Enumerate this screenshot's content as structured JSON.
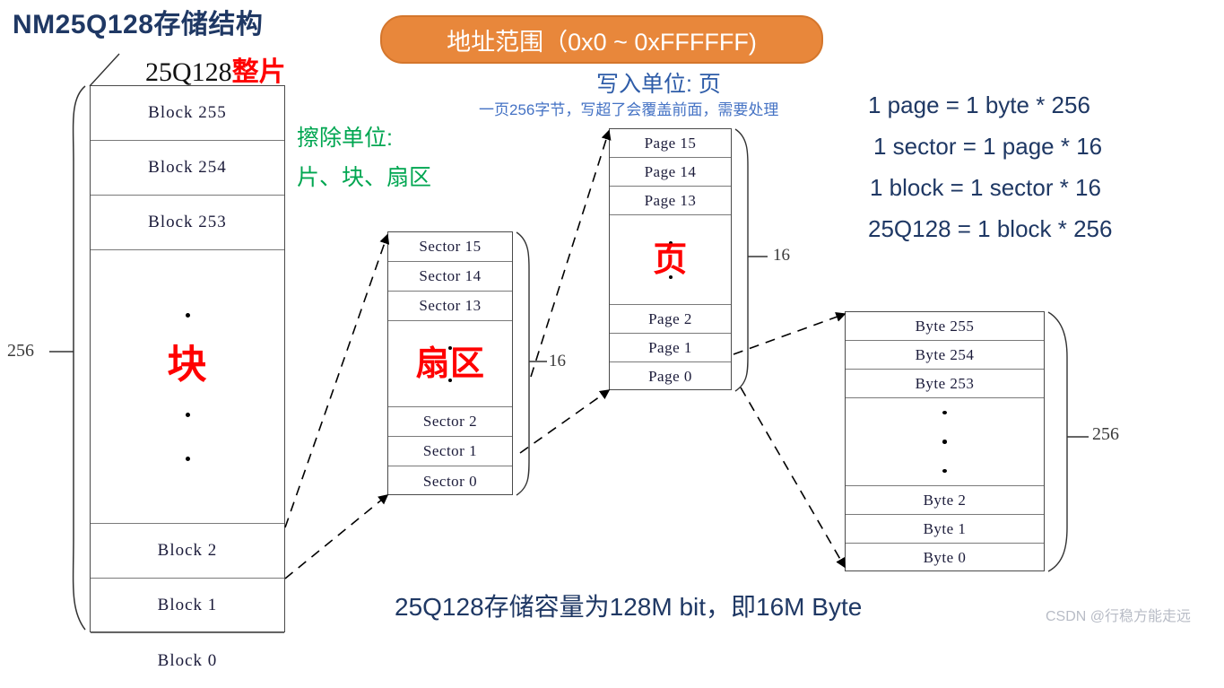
{
  "title": "NM25Q128存储结构",
  "chip_label": {
    "prefix": "25Q128",
    "highlight": "整片"
  },
  "address_badge": "地址范围（0x0 ~ 0xFFFFFF)",
  "annotations": {
    "write_unit": "写入单位: 页",
    "write_note": "一页256字节，写超了会覆盖前面，需要处理",
    "erase_unit": "擦除单位:",
    "erase_list": "片、块、扇区"
  },
  "equations": [
    "1 page = 1 byte * 256",
    "1 sector = 1 page * 16",
    "1 block = 1 sector * 16",
    "25Q128 = 1 block * 256"
  ],
  "columns": {
    "block": {
      "name": "Block",
      "top_cells": [
        "Block 255",
        "Block 254",
        "Block 253"
      ],
      "middle_label": "块",
      "bottom_cells": [
        "Block 2",
        "Block 1",
        "Block 0"
      ],
      "count_label": "256"
    },
    "sector": {
      "name": "Sector",
      "top_cells": [
        "Sector 15",
        "Sector 14",
        "Sector 13"
      ],
      "middle_label": "扇区",
      "bottom_cells": [
        "Sector 2",
        "Sector 1",
        "Sector 0"
      ],
      "count_label": "16"
    },
    "page": {
      "name": "Page",
      "top_cells": [
        "Page 15",
        "Page 14",
        "Page 13"
      ],
      "middle_label": "页",
      "bottom_cells": [
        "Page 2",
        "Page 1",
        "Page 0"
      ],
      "count_label": "16"
    },
    "byte": {
      "name": "Byte",
      "top_cells": [
        "Byte 255",
        "Byte 254",
        "Byte 253"
      ],
      "middle_label": "",
      "bottom_cells": [
        "Byte 2",
        "Byte 1",
        "Byte 0"
      ],
      "count_label": "256"
    }
  },
  "bottom_caption": "25Q128存储容量为128M bit，即16M Byte",
  "watermark": "CSDN @行稳方能走远",
  "colors": {
    "title": "#1F3864",
    "badge_bg": "#E8873B",
    "blue_note": "#4472C4",
    "green_note": "#00A651",
    "red_label": "#FF0000"
  }
}
